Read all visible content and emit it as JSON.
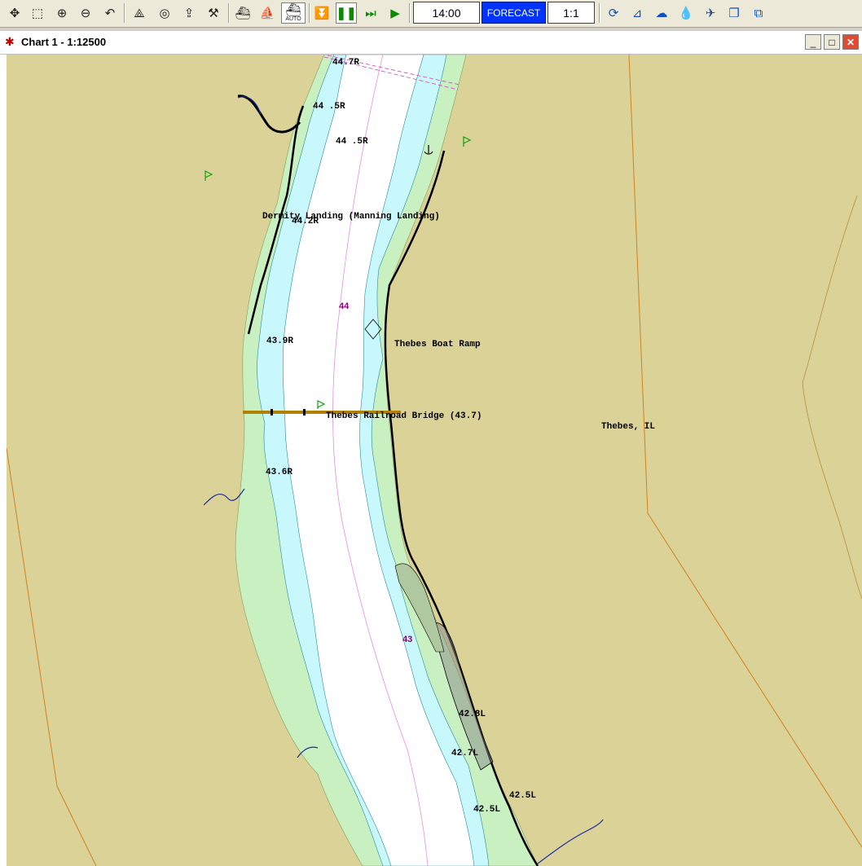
{
  "toolbar": {
    "time": "14:00",
    "forecast_label": "FORECAST",
    "scale_label": "1:1",
    "auto_label": "AUTO"
  },
  "window": {
    "title": "Chart 1 - 1:12500"
  },
  "map_labels": {
    "m447r": "44.7R",
    "m445r_a": "44 .5R",
    "m445r_b": "44 .5R",
    "landing": "Dermity Landing (Manning Landing)",
    "m442r": "44.2R",
    "mile44": "44",
    "boat_ramp": "Thebes Boat Ramp",
    "m439r": "43.9R",
    "bridge": "Thebes Railroad Bridge (43.7)",
    "town": "Thebes, IL",
    "m436r": "43.6R",
    "mile43": "43",
    "m428l": "42.8L",
    "m427l": "42.7L",
    "m425l_a": "42.5L",
    "m425l_b": "42.5L"
  },
  "colors": {
    "land": "#dbd297",
    "shallow": "#c8f0c0",
    "water": "#c8f8fc",
    "channel": "#ffffff",
    "forecast_bg": "#0033ff",
    "bridge": "#b08000",
    "mile_marker": "#8a007a"
  }
}
